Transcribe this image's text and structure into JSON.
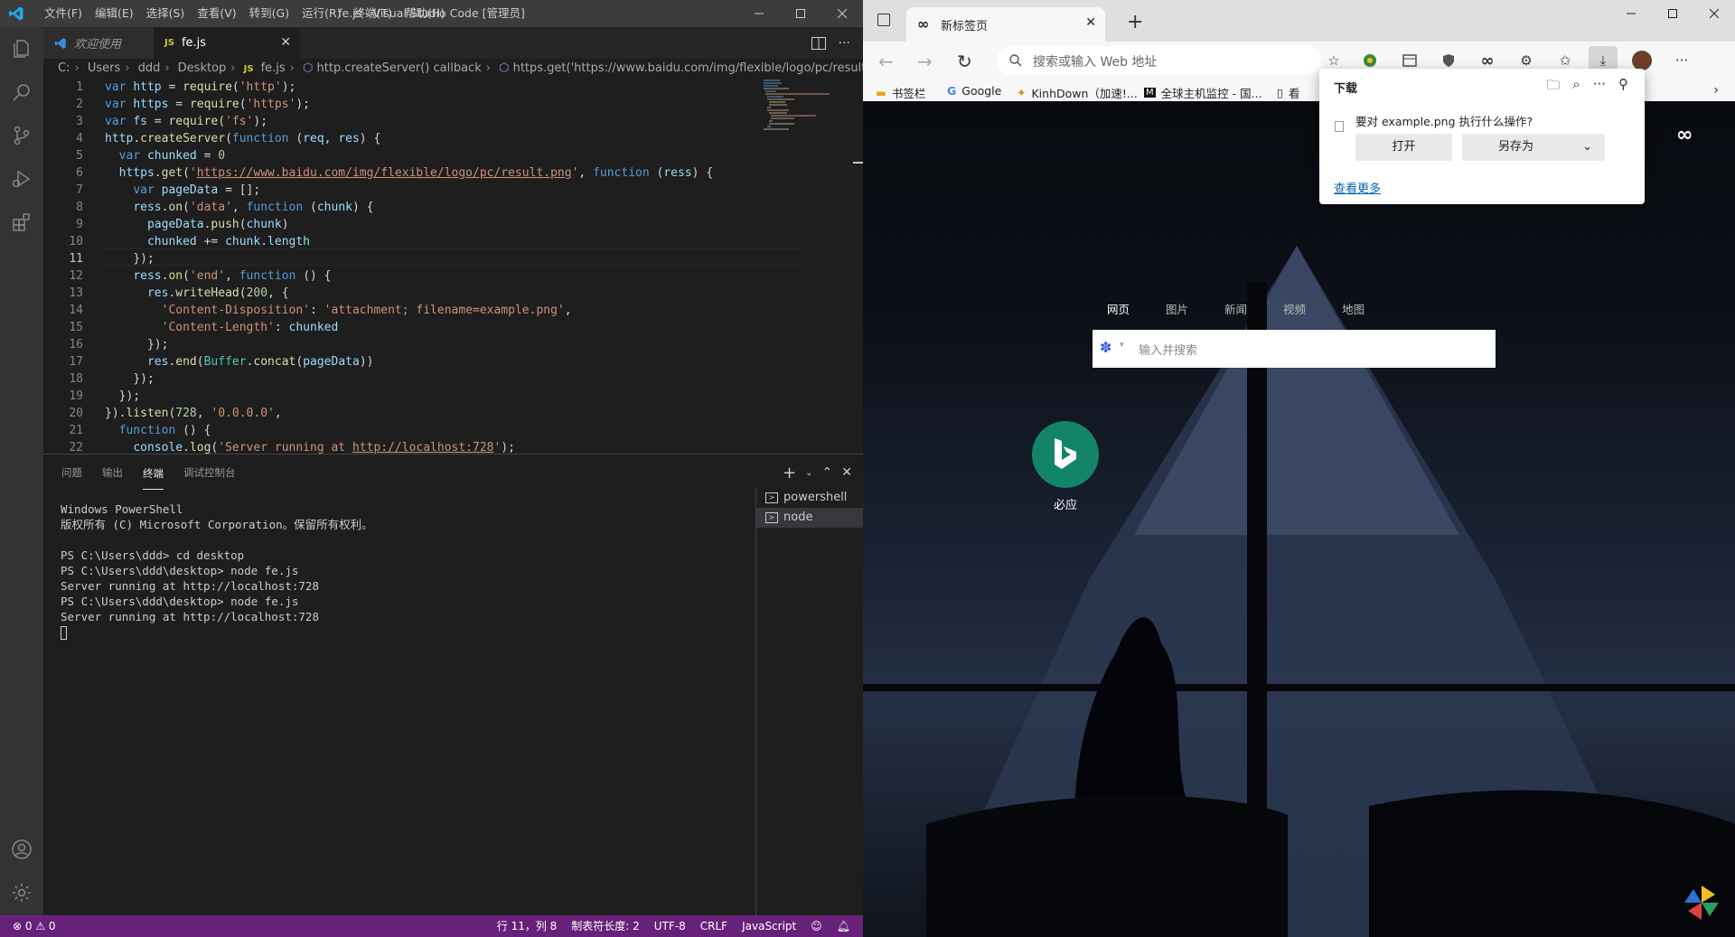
{
  "vscode": {
    "menu": [
      "文件(F)",
      "编辑(E)",
      "选择(S)",
      "查看(V)",
      "转到(G)",
      "运行(R)",
      "终端(T)",
      "帮助(H)"
    ],
    "window_title": "fe.js - Visual Studio Code [管理员]",
    "tabs": [
      {
        "label": "欢迎使用"
      },
      {
        "label": "fe.js",
        "badge": "JS"
      }
    ],
    "breadcrumb": [
      "C:",
      "Users",
      "ddd",
      "Desktop",
      "fe.js",
      "http.createServer() callback",
      "https.get('https://www.baidu.com/img/flexible/logo/pc/result.png') callback"
    ],
    "active_line": 11,
    "line_numbers": [
      "1",
      "2",
      "3",
      "4",
      "5",
      "6",
      "7",
      "8",
      "9",
      "10",
      "11",
      "12",
      "13",
      "14",
      "15",
      "16",
      "17",
      "18",
      "19",
      "20",
      "21",
      "22"
    ],
    "panel_tabs": [
      "问题",
      "输出",
      "终端",
      "调试控制台"
    ],
    "active_panel_tab": "终端",
    "terminal_lines": [
      "Windows PowerShell",
      "版权所有 (C) Microsoft Corporation。保留所有权利。",
      "",
      "PS C:\\Users\\ddd> cd desktop",
      "PS C:\\Users\\ddd\\desktop> node fe.js",
      "Server running at http://localhost:728",
      "PS C:\\Users\\ddd\\desktop> node fe.js",
      "Server running at http://localhost:728"
    ],
    "terminal_list": [
      {
        "label": "powershell",
        "selected": false
      },
      {
        "label": "node",
        "selected": true
      }
    ],
    "status": {
      "errors": "0",
      "warnings": "0",
      "position": "行 11，列 8",
      "tab_size": "制表符长度: 2",
      "encoding": "UTF-8",
      "eol": "CRLF",
      "language": "JavaScript"
    },
    "colors": {
      "status_bar": "#68217a",
      "activity_bar": "#333333",
      "editor_bg": "#1e1e1e"
    }
  },
  "edge": {
    "tab_title": "新标签页",
    "address_placeholder": "搜索或输入 Web 地址",
    "bookmarks": [
      "书签栏",
      "Google",
      "KinhDown（加速!...",
      "全球主机监控 - 国...",
      "看"
    ],
    "search_tabs": [
      "网页",
      "图片",
      "新闻",
      "视频",
      "地图"
    ],
    "search_placeholder": "输入并搜索",
    "shortcut_label": "必应",
    "download": {
      "title": "下载",
      "question": "要对 example.png 执行什么操作?",
      "open": "打开",
      "save_as": "另存为",
      "see_more": "查看更多"
    }
  }
}
